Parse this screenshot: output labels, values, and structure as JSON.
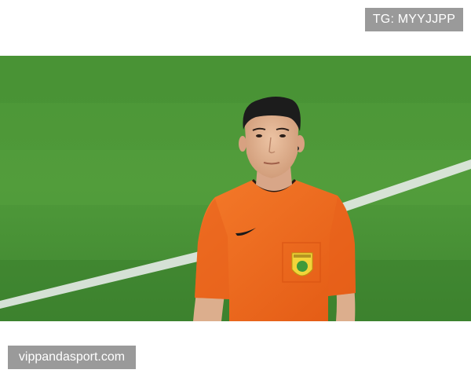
{
  "watermark_top": "TG: MYYJJPP",
  "watermark_bottom": "vippandasport.com",
  "photo": {
    "subject": "referee-photo",
    "colors": {
      "grass_light": "#4f9a3a",
      "grass_dark": "#3f8530",
      "jersey": "#f26a1f",
      "skin": "#e0b08f",
      "hair": "#1c1c1c",
      "field_line": "#e8ecea",
      "badge": "#f2d43a"
    }
  }
}
